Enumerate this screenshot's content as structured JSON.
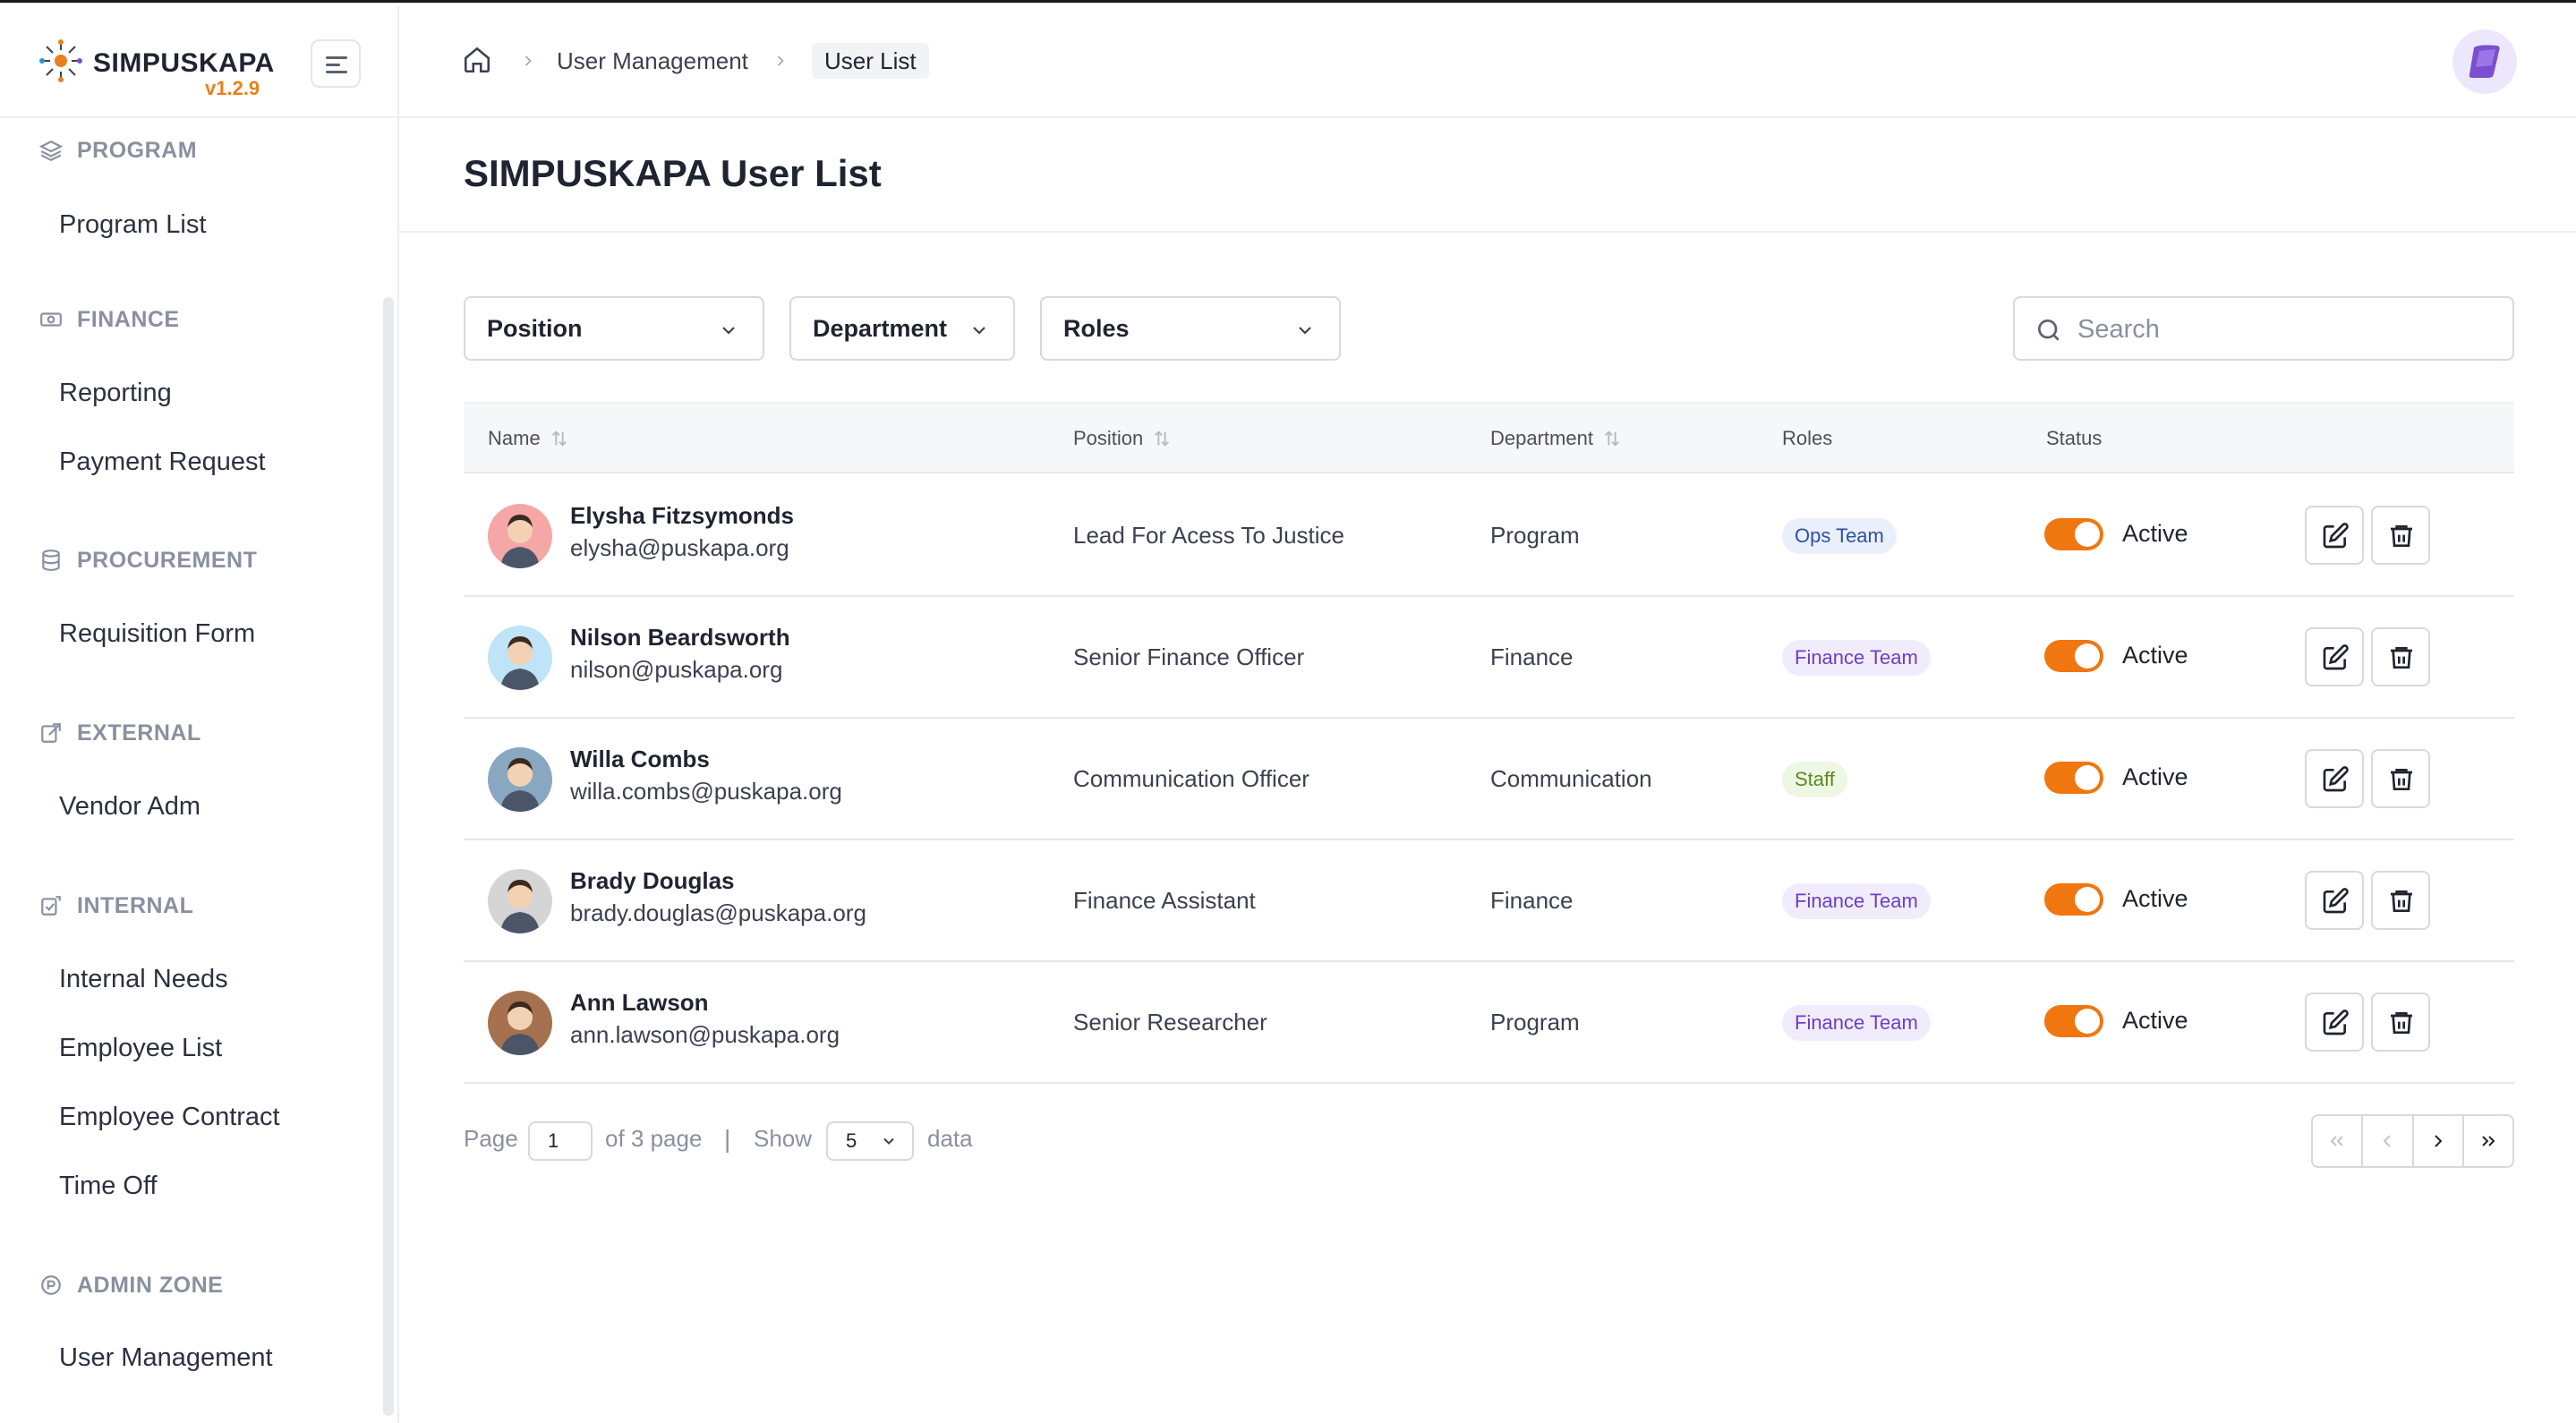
{
  "app": {
    "name": "SIMPUSKAPA",
    "version": "v1.2.9"
  },
  "sidebar": {
    "sections": [
      {
        "title": "PROGRAM",
        "icon": "layers-icon",
        "items": [
          "Program List"
        ]
      },
      {
        "title": "FINANCE",
        "icon": "cash-icon",
        "items": [
          "Reporting",
          "Payment Request"
        ]
      },
      {
        "title": "PROCUREMENT",
        "icon": "database-icon",
        "items": [
          "Requisition Form"
        ]
      },
      {
        "title": "EXTERNAL",
        "icon": "external-icon",
        "items": [
          "Vendor Adm"
        ]
      },
      {
        "title": "INTERNAL",
        "icon": "internal-icon",
        "items": [
          "Internal Needs",
          "Employee List",
          "Employee Contract",
          "Time Off"
        ]
      },
      {
        "title": "ADMIN ZONE",
        "icon": "admin-icon",
        "items": [
          "User Management"
        ]
      }
    ]
  },
  "breadcrumb": {
    "items": [
      "User Management",
      "User List"
    ]
  },
  "page": {
    "title": "SIMPUSKAPA User List"
  },
  "filters": {
    "position": "Position",
    "department": "Department",
    "roles": "Roles",
    "search_placeholder": "Search"
  },
  "table": {
    "headers": {
      "name": "Name",
      "position": "Position",
      "department": "Department",
      "roles": "Roles",
      "status": "Status"
    },
    "rows": [
      {
        "name": "Elysha Fitzsymonds",
        "email": "elysha@puskapa.org",
        "position": "Lead For Acess To Justice",
        "department": "Program",
        "role": "Ops Team",
        "role_type": "ops",
        "status": "Active",
        "avatar_bg": "#f5a6a6"
      },
      {
        "name": "Nilson Beardsworth",
        "email": "nilson@puskapa.org",
        "position": "Senior Finance Officer",
        "department": "Finance",
        "role": "Finance Team",
        "role_type": "fin",
        "status": "Active",
        "avatar_bg": "#bfe3f7"
      },
      {
        "name": "Willa Combs",
        "email": "willa.combs@puskapa.org",
        "position": "Communication Officer",
        "department": "Communication",
        "role": "Staff",
        "role_type": "staff",
        "status": "Active",
        "avatar_bg": "#8aa7c2"
      },
      {
        "name": "Brady Douglas",
        "email": "brady.douglas@puskapa.org",
        "position": "Finance Assistant",
        "department": "Finance",
        "role": "Finance Team",
        "role_type": "fin",
        "status": "Active",
        "avatar_bg": "#d5d5d5"
      },
      {
        "name": "Ann Lawson",
        "email": "ann.lawson@puskapa.org",
        "position": "Senior Researcher",
        "department": "Program",
        "role": "Finance Team",
        "role_type": "fin",
        "status": "Active",
        "avatar_bg": "#a5714f"
      }
    ]
  },
  "pagination": {
    "page_label": "Page",
    "current_page": "1",
    "of_label": "of 3 page",
    "separator": "|",
    "show_label": "Show",
    "page_size": "5",
    "data_label": "data"
  },
  "colors": {
    "accent": "#f0760f",
    "brand_version": "#e8801f"
  }
}
